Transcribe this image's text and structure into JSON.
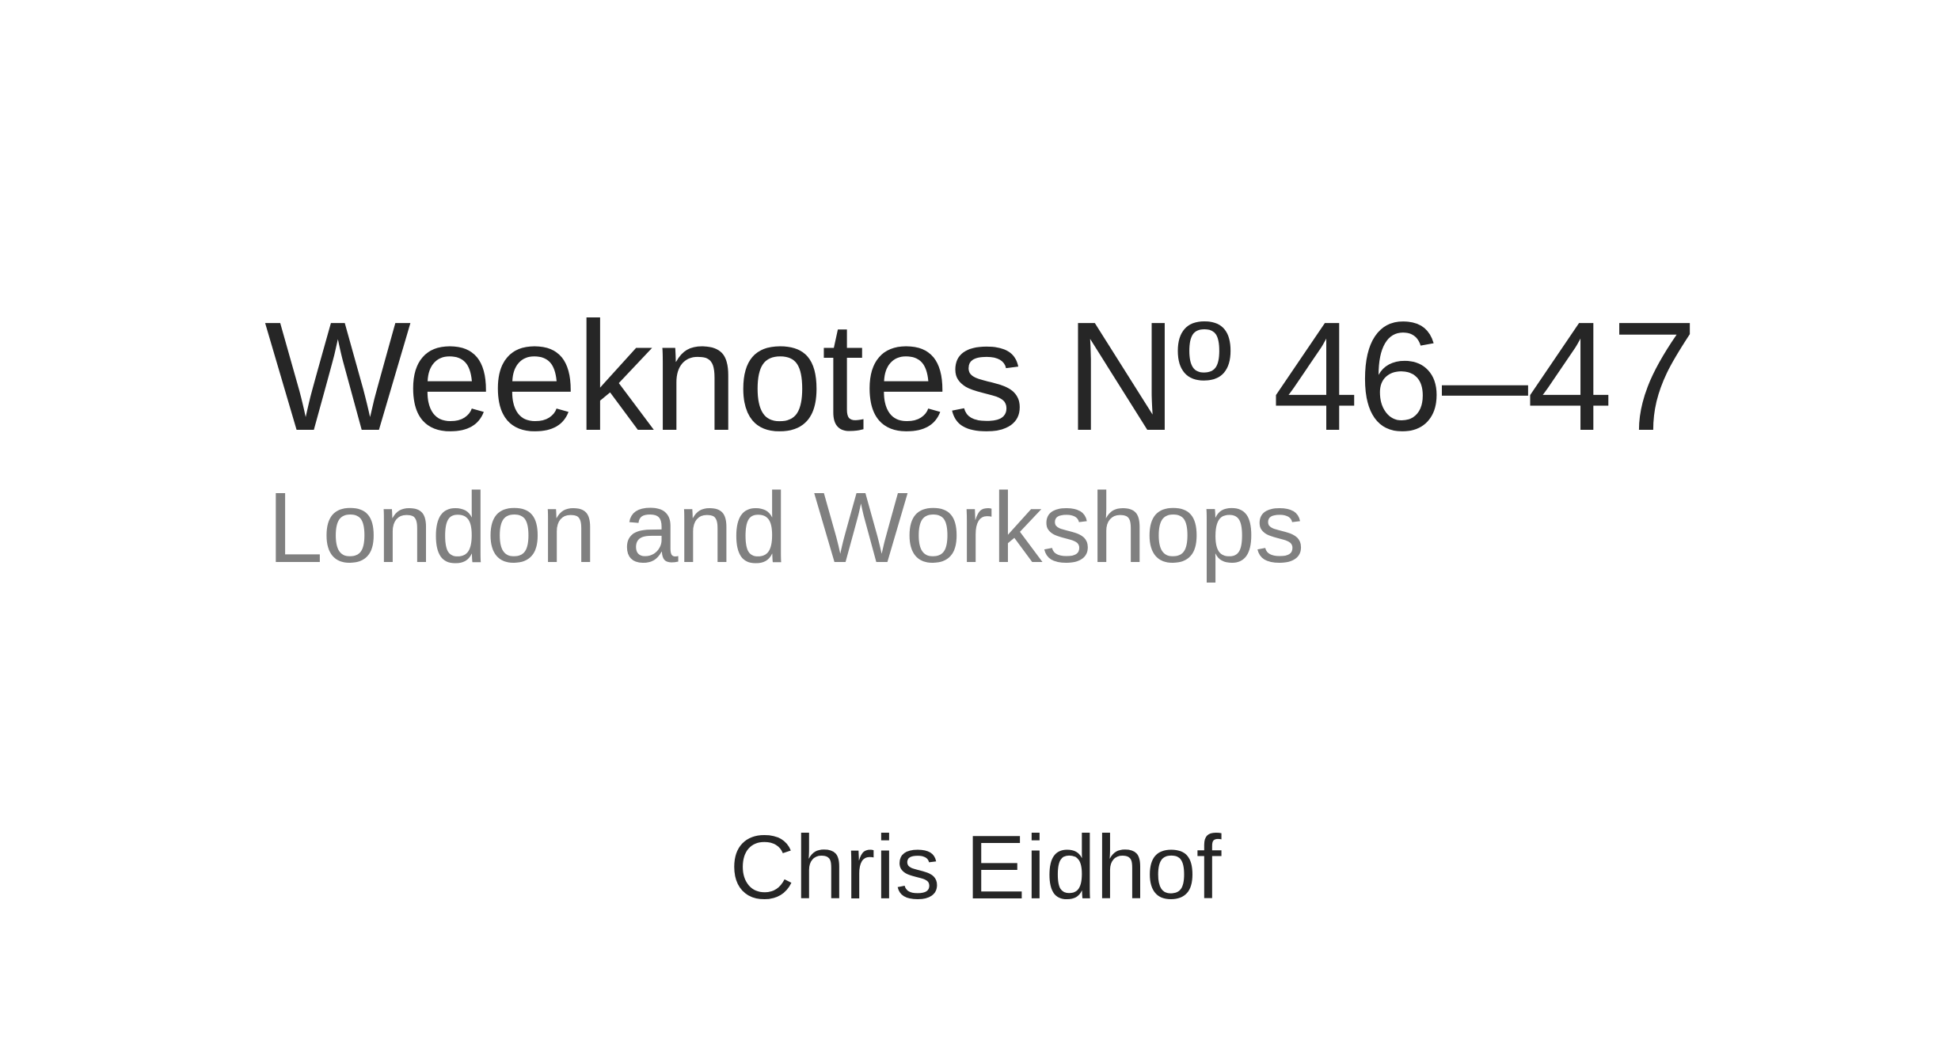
{
  "slide": {
    "title": "Weeknotes Nº 46–47",
    "subtitle": "London and Workshops",
    "author": "Chris Eidhof"
  },
  "colors": {
    "background": "#ffffff",
    "title": "#262626",
    "subtitle": "#808080",
    "author": "#262626"
  }
}
